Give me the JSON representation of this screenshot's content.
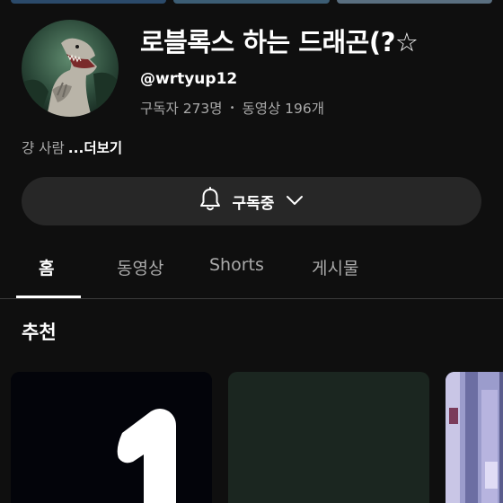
{
  "channel": {
    "name": "로블록스 하는 드래곤(?☆",
    "handle": "@wrtyup12",
    "subscribers": "구독자 273명",
    "videos": "동영상 196개",
    "separator": "•",
    "description": "걍 사람",
    "more_label": "...더보기"
  },
  "subscribe": {
    "label": "구독중",
    "bell_icon": "bell-icon",
    "chevron_icon": "chevron-down-icon"
  },
  "tabs": [
    {
      "label": "홈",
      "active": true
    },
    {
      "label": "동영상",
      "active": false
    },
    {
      "label": "Shorts",
      "active": false
    },
    {
      "label": "게시물",
      "active": false
    }
  ],
  "section": {
    "title": "추천"
  },
  "colors": {
    "background": "#0f0f0f",
    "button_bg": "#272727",
    "text_primary": "#ffffff",
    "text_secondary": "#aaaaaa"
  },
  "thumbnails": [
    {
      "label": "1"
    },
    {
      "label": ""
    },
    {
      "label": ""
    }
  ]
}
